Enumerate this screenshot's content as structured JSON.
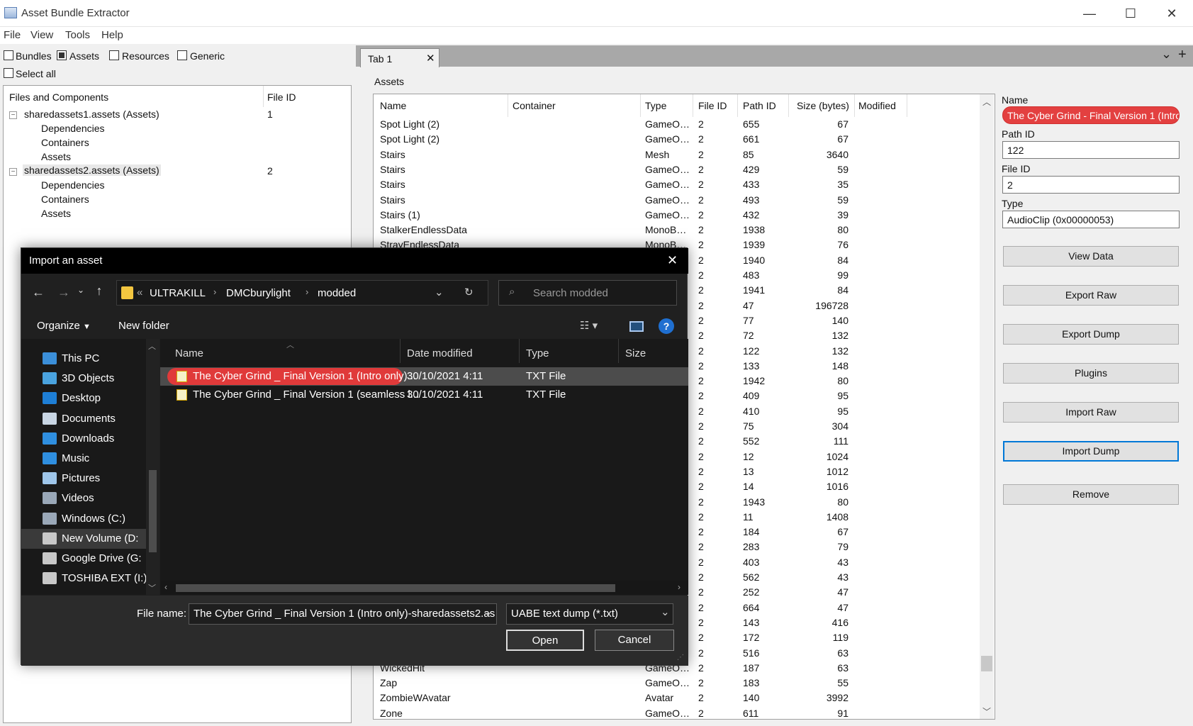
{
  "window": {
    "title": "Asset Bundle Extractor",
    "minimize": "—",
    "maximize": "☐",
    "close": "✕"
  },
  "menu": [
    "File",
    "View",
    "Tools",
    "Help"
  ],
  "filters": {
    "bundles": "Bundles",
    "assets": "Assets",
    "resources": "Resources",
    "generic": "Generic",
    "select_all": "Select all"
  },
  "tree": {
    "col_files": "Files and Components",
    "col_fileid": "File ID",
    "items": [
      {
        "label": "sharedassets1.assets (Assets)",
        "id": "1",
        "children": [
          "Dependencies",
          "Containers",
          "Assets"
        ]
      },
      {
        "label": "sharedassets2.assets (Assets)",
        "id": "2",
        "children": [
          "Dependencies",
          "Containers",
          "Assets"
        ]
      }
    ]
  },
  "tabs": {
    "tab1": "Tab 1",
    "close": "✕",
    "dropdown": "⌄",
    "add": "+"
  },
  "assets": {
    "title": "Assets",
    "columns": [
      "Name",
      "Container",
      "Type",
      "File ID",
      "Path ID",
      "Size (bytes)",
      "Modified"
    ],
    "rows": [
      [
        "Spot Light (2)",
        "GameO…",
        "2",
        "655",
        "67"
      ],
      [
        "Spot Light (2)",
        "GameO…",
        "2",
        "661",
        "67"
      ],
      [
        "Stairs",
        "Mesh",
        "2",
        "85",
        "3640"
      ],
      [
        "Stairs",
        "GameO…",
        "2",
        "429",
        "59"
      ],
      [
        "Stairs",
        "GameO…",
        "2",
        "433",
        "35"
      ],
      [
        "Stairs",
        "GameO…",
        "2",
        "493",
        "59"
      ],
      [
        "Stairs (1)",
        "GameO…",
        "2",
        "432",
        "39"
      ],
      [
        "StalkerEndlessData",
        "MonoB…",
        "2",
        "1938",
        "80"
      ],
      [
        "StrayEndlessData",
        "MonoB…",
        "2",
        "1939",
        "76"
      ],
      [
        "",
        "",
        "2",
        "1940",
        "84"
      ],
      [
        "",
        "",
        "2",
        "483",
        "99"
      ],
      [
        "",
        "",
        "2",
        "1941",
        "84"
      ],
      [
        "",
        "",
        "2",
        "47",
        "196728"
      ],
      [
        "",
        "",
        "2",
        "77",
        "140"
      ],
      [
        "",
        "",
        "2",
        "72",
        "132"
      ],
      [
        "",
        "",
        "2",
        "122",
        "132"
      ],
      [
        "",
        "",
        "2",
        "133",
        "148"
      ],
      [
        "",
        "",
        "2",
        "1942",
        "80"
      ],
      [
        "",
        "",
        "2",
        "409",
        "95"
      ],
      [
        "",
        "",
        "2",
        "410",
        "95"
      ],
      [
        "",
        "",
        "2",
        "75",
        "304"
      ],
      [
        "",
        "",
        "2",
        "552",
        "111"
      ],
      [
        "",
        "",
        "2",
        "12",
        "1024"
      ],
      [
        "",
        "",
        "2",
        "13",
        "1012"
      ],
      [
        "",
        "",
        "2",
        "14",
        "1016"
      ],
      [
        "",
        "",
        "2",
        "1943",
        "80"
      ],
      [
        "",
        "",
        "2",
        "11",
        "1408"
      ],
      [
        "",
        "",
        "2",
        "184",
        "67"
      ],
      [
        "",
        "",
        "2",
        "283",
        "79"
      ],
      [
        "",
        "",
        "2",
        "403",
        "43"
      ],
      [
        "",
        "",
        "2",
        "562",
        "43"
      ],
      [
        "",
        "",
        "2",
        "252",
        "47"
      ],
      [
        "",
        "",
        "2",
        "664",
        "47"
      ],
      [
        "",
        "",
        "2",
        "143",
        "416"
      ],
      [
        "",
        "",
        "2",
        "172",
        "119"
      ],
      [
        "",
        "",
        "2",
        "516",
        "63"
      ],
      [
        "WickedHit",
        "GameO…",
        "2",
        "187",
        "63"
      ],
      [
        "Zap",
        "GameO…",
        "2",
        "183",
        "55"
      ],
      [
        "ZombieWAvatar",
        "Avatar",
        "2",
        "140",
        "3992"
      ],
      [
        "Zone",
        "GameO…",
        "2",
        "611",
        "91"
      ]
    ]
  },
  "panel": {
    "name_label": "Name",
    "name_value": "The Cyber Grind - Final Version 1 (Intro",
    "pathid_label": "Path ID",
    "pathid_value": "122",
    "fileid_label": "File ID",
    "fileid_value": "2",
    "type_label": "Type",
    "type_value": "AudioClip (0x00000053)",
    "buttons": [
      "View Data",
      "Export Raw",
      "Export Dump",
      "Plugins",
      "Import Raw",
      "Import Dump",
      "Remove"
    ]
  },
  "dialog": {
    "title": "Import an asset",
    "path": [
      "ULTRAKILL",
      "DMCburylight",
      "modded"
    ],
    "search_placeholder": "Search modded",
    "organize": "Organize",
    "new_folder": "New folder",
    "help": "?",
    "nav": [
      {
        "label": "This PC",
        "icon": "computer-icon",
        "color": "#3b8fd9"
      },
      {
        "label": "3D Objects",
        "icon": "cube-icon",
        "color": "#4aa3df"
      },
      {
        "label": "Desktop",
        "icon": "desktop-icon",
        "color": "#1e7fd6"
      },
      {
        "label": "Documents",
        "icon": "document-icon",
        "color": "#c9d6e4"
      },
      {
        "label": "Downloads",
        "icon": "download-icon",
        "color": "#2f8fe0"
      },
      {
        "label": "Music",
        "icon": "music-icon",
        "color": "#2f8fe0"
      },
      {
        "label": "Pictures",
        "icon": "picture-icon",
        "color": "#9fc6ea"
      },
      {
        "label": "Videos",
        "icon": "video-icon",
        "color": "#9aa8b8"
      },
      {
        "label": "Windows (C:)",
        "icon": "drive-icon",
        "color": "#9aa8b8"
      },
      {
        "label": "New Volume (D:",
        "icon": "drive-icon",
        "color": "#c8c8c8"
      },
      {
        "label": "Google Drive (G:",
        "icon": "drive-icon",
        "color": "#c8c8c8"
      },
      {
        "label": "TOSHIBA EXT (I:)",
        "icon": "drive-icon",
        "color": "#c8c8c8"
      }
    ],
    "columns": [
      "Name",
      "Date modified",
      "Type",
      "Size"
    ],
    "files": [
      {
        "name": "The Cyber Grind _ Final Version 1 (Intro only)...",
        "date": "30/10/2021 4:11",
        "type": "TXT File"
      },
      {
        "name": "The Cyber Grind _ Final Version 1 (seamless l...",
        "date": "30/10/2021 4:11",
        "type": "TXT File"
      }
    ],
    "filename_label": "File name:",
    "filename_value": "The Cyber Grind _ Final Version 1 (Intro only)-sharedassets2.as",
    "filetype_value": "UABE text dump (*.txt)",
    "open": "Open",
    "cancel": "Cancel"
  },
  "colors": {
    "highlight": "#e34040",
    "focus": "#0078d7",
    "dialog_bg": "#202020"
  }
}
